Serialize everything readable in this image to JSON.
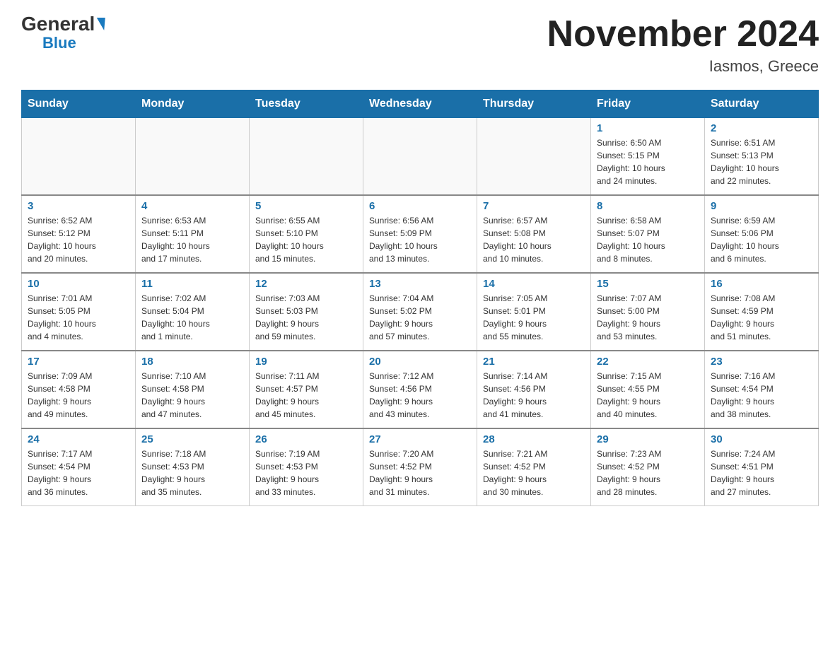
{
  "header": {
    "logo_general": "General",
    "logo_blue": "Blue",
    "month_title": "November 2024",
    "location": "Iasmos, Greece"
  },
  "days_of_week": [
    "Sunday",
    "Monday",
    "Tuesday",
    "Wednesday",
    "Thursday",
    "Friday",
    "Saturday"
  ],
  "weeks": [
    {
      "days": [
        {
          "num": "",
          "info": ""
        },
        {
          "num": "",
          "info": ""
        },
        {
          "num": "",
          "info": ""
        },
        {
          "num": "",
          "info": ""
        },
        {
          "num": "",
          "info": ""
        },
        {
          "num": "1",
          "info": "Sunrise: 6:50 AM\nSunset: 5:15 PM\nDaylight: 10 hours\nand 24 minutes."
        },
        {
          "num": "2",
          "info": "Sunrise: 6:51 AM\nSunset: 5:13 PM\nDaylight: 10 hours\nand 22 minutes."
        }
      ]
    },
    {
      "days": [
        {
          "num": "3",
          "info": "Sunrise: 6:52 AM\nSunset: 5:12 PM\nDaylight: 10 hours\nand 20 minutes."
        },
        {
          "num": "4",
          "info": "Sunrise: 6:53 AM\nSunset: 5:11 PM\nDaylight: 10 hours\nand 17 minutes."
        },
        {
          "num": "5",
          "info": "Sunrise: 6:55 AM\nSunset: 5:10 PM\nDaylight: 10 hours\nand 15 minutes."
        },
        {
          "num": "6",
          "info": "Sunrise: 6:56 AM\nSunset: 5:09 PM\nDaylight: 10 hours\nand 13 minutes."
        },
        {
          "num": "7",
          "info": "Sunrise: 6:57 AM\nSunset: 5:08 PM\nDaylight: 10 hours\nand 10 minutes."
        },
        {
          "num": "8",
          "info": "Sunrise: 6:58 AM\nSunset: 5:07 PM\nDaylight: 10 hours\nand 8 minutes."
        },
        {
          "num": "9",
          "info": "Sunrise: 6:59 AM\nSunset: 5:06 PM\nDaylight: 10 hours\nand 6 minutes."
        }
      ]
    },
    {
      "days": [
        {
          "num": "10",
          "info": "Sunrise: 7:01 AM\nSunset: 5:05 PM\nDaylight: 10 hours\nand 4 minutes."
        },
        {
          "num": "11",
          "info": "Sunrise: 7:02 AM\nSunset: 5:04 PM\nDaylight: 10 hours\nand 1 minute."
        },
        {
          "num": "12",
          "info": "Sunrise: 7:03 AM\nSunset: 5:03 PM\nDaylight: 9 hours\nand 59 minutes."
        },
        {
          "num": "13",
          "info": "Sunrise: 7:04 AM\nSunset: 5:02 PM\nDaylight: 9 hours\nand 57 minutes."
        },
        {
          "num": "14",
          "info": "Sunrise: 7:05 AM\nSunset: 5:01 PM\nDaylight: 9 hours\nand 55 minutes."
        },
        {
          "num": "15",
          "info": "Sunrise: 7:07 AM\nSunset: 5:00 PM\nDaylight: 9 hours\nand 53 minutes."
        },
        {
          "num": "16",
          "info": "Sunrise: 7:08 AM\nSunset: 4:59 PM\nDaylight: 9 hours\nand 51 minutes."
        }
      ]
    },
    {
      "days": [
        {
          "num": "17",
          "info": "Sunrise: 7:09 AM\nSunset: 4:58 PM\nDaylight: 9 hours\nand 49 minutes."
        },
        {
          "num": "18",
          "info": "Sunrise: 7:10 AM\nSunset: 4:58 PM\nDaylight: 9 hours\nand 47 minutes."
        },
        {
          "num": "19",
          "info": "Sunrise: 7:11 AM\nSunset: 4:57 PM\nDaylight: 9 hours\nand 45 minutes."
        },
        {
          "num": "20",
          "info": "Sunrise: 7:12 AM\nSunset: 4:56 PM\nDaylight: 9 hours\nand 43 minutes."
        },
        {
          "num": "21",
          "info": "Sunrise: 7:14 AM\nSunset: 4:56 PM\nDaylight: 9 hours\nand 41 minutes."
        },
        {
          "num": "22",
          "info": "Sunrise: 7:15 AM\nSunset: 4:55 PM\nDaylight: 9 hours\nand 40 minutes."
        },
        {
          "num": "23",
          "info": "Sunrise: 7:16 AM\nSunset: 4:54 PM\nDaylight: 9 hours\nand 38 minutes."
        }
      ]
    },
    {
      "days": [
        {
          "num": "24",
          "info": "Sunrise: 7:17 AM\nSunset: 4:54 PM\nDaylight: 9 hours\nand 36 minutes."
        },
        {
          "num": "25",
          "info": "Sunrise: 7:18 AM\nSunset: 4:53 PM\nDaylight: 9 hours\nand 35 minutes."
        },
        {
          "num": "26",
          "info": "Sunrise: 7:19 AM\nSunset: 4:53 PM\nDaylight: 9 hours\nand 33 minutes."
        },
        {
          "num": "27",
          "info": "Sunrise: 7:20 AM\nSunset: 4:52 PM\nDaylight: 9 hours\nand 31 minutes."
        },
        {
          "num": "28",
          "info": "Sunrise: 7:21 AM\nSunset: 4:52 PM\nDaylight: 9 hours\nand 30 minutes."
        },
        {
          "num": "29",
          "info": "Sunrise: 7:23 AM\nSunset: 4:52 PM\nDaylight: 9 hours\nand 28 minutes."
        },
        {
          "num": "30",
          "info": "Sunrise: 7:24 AM\nSunset: 4:51 PM\nDaylight: 9 hours\nand 27 minutes."
        }
      ]
    }
  ]
}
